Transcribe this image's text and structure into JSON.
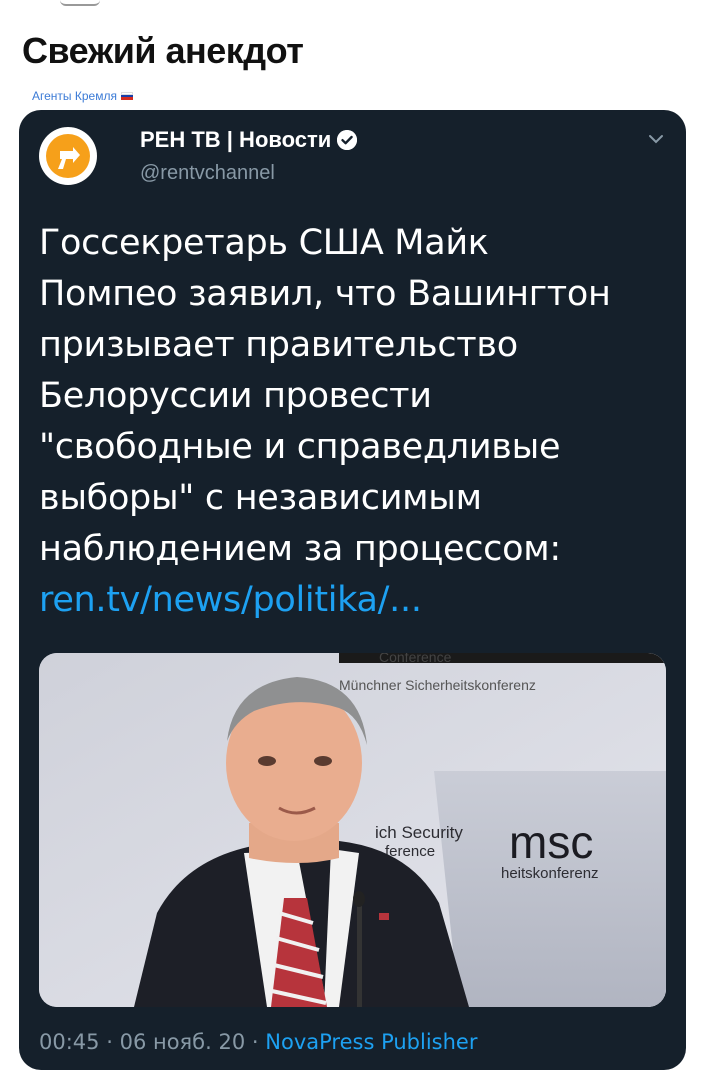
{
  "post": {
    "title": "Свежий анекдот",
    "source": "Агенты Кремля"
  },
  "colors": {
    "card_background": "#15202b",
    "link": "#1da1f2",
    "muted": "#8899a6",
    "brand_orange": "#f6a01a"
  },
  "tweet": {
    "account_name": "РЕН ТВ | Новости",
    "handle": "@rentvchannel",
    "avatar_icon": "ren-tv-logo-icon",
    "verified_icon": "verified-badge-icon",
    "menu_icon": "chevron-down-icon",
    "text_lines": [
      "Госсекретарь США Майк",
      "Помпео заявил, что Вашингтон",
      "призывает правительство",
      "Белоруссии провести",
      "\"свободные и справедливые",
      "выборы\" с независимым",
      "наблюдением за процессом:"
    ],
    "link": "ren.tv/news/politika/...",
    "photo": {
      "banner_top_line1": "Conference",
      "banner_top_line2": "Münchner Sicherheitskonferenz",
      "sign_line1": "ich Security",
      "sign_line2": "ference",
      "sign_logo": "msc",
      "sign_line3": "heitskonferenz"
    },
    "time": "00:45",
    "date": "06 нояб. 20",
    "client": "NovaPress Publisher"
  }
}
